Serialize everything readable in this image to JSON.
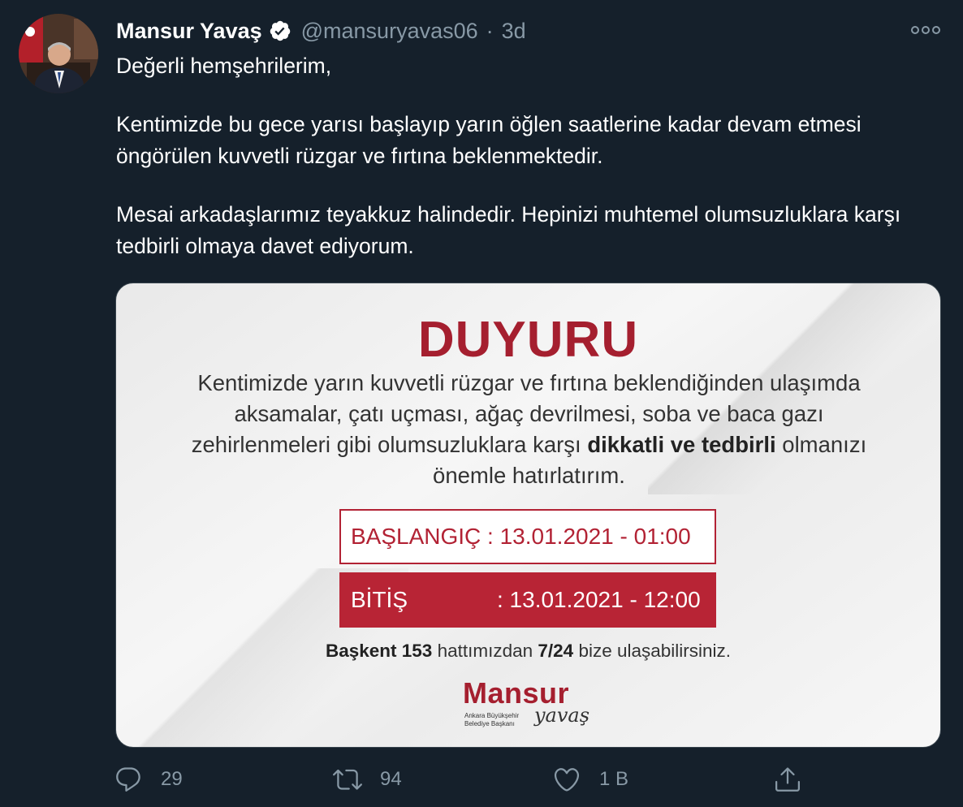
{
  "tweet": {
    "author_name": "Mansur Yavaş",
    "handle": "@mansuryavas06",
    "separator": "·",
    "time": "3d",
    "paragraphs": [
      "Değerli hemşehrilerim,",
      "Kentimizde bu gece yarısı başlayıp yarın öğlen saatlerine kadar devam etmesi öngörülen kuvvetli rüzgar ve fırtına beklenmektedir.",
      "Mesai arkadaşlarımız teyakkuz halindedir. Hepinizi muhtemel olumsuzluklara karşı tedbirli olmaya davet ediyorum."
    ]
  },
  "media": {
    "heading": "DUYURU",
    "notice_text": "Kentimizde yarın kuvvetli rüzgar ve fırtına beklendiğinden ulaşımda aksamalar, çatı uçması, ağaç devrilmesi, soba ve baca gazı zehirlenmeleri gibi olumsuzluklara karşı ",
    "notice_bold": "dikkatli ve tedbirli",
    "notice_end": " olmanızı önemle hatırlatırım.",
    "start_text": "BAŞLANGIÇ : 13.01.2021 - 01:00",
    "end_label": "BİTİŞ",
    "end_value": ": 13.01.2021 - 12:00",
    "contact_bold1": "Başkent 153",
    "contact_mid": " hattımızdan ",
    "contact_bold2": "7/24",
    "contact_end": " bize ulaşabilirsiniz.",
    "logo_main": "Mansur",
    "logo_sub": "Ankara Büyükşehir Belediye Başkanı",
    "logo_script": "yavaş",
    "accent_color": "#a51f2f"
  },
  "actions": {
    "reply_count": "29",
    "retweet_count": "94",
    "like_count": "1 B"
  },
  "colors": {
    "background": "#15202b",
    "secondary_text": "#8899a6",
    "verified": "#ffffff"
  },
  "icons": [
    "verified-badge-icon",
    "more-icon",
    "reply-icon",
    "retweet-icon",
    "like-icon",
    "share-icon"
  ]
}
